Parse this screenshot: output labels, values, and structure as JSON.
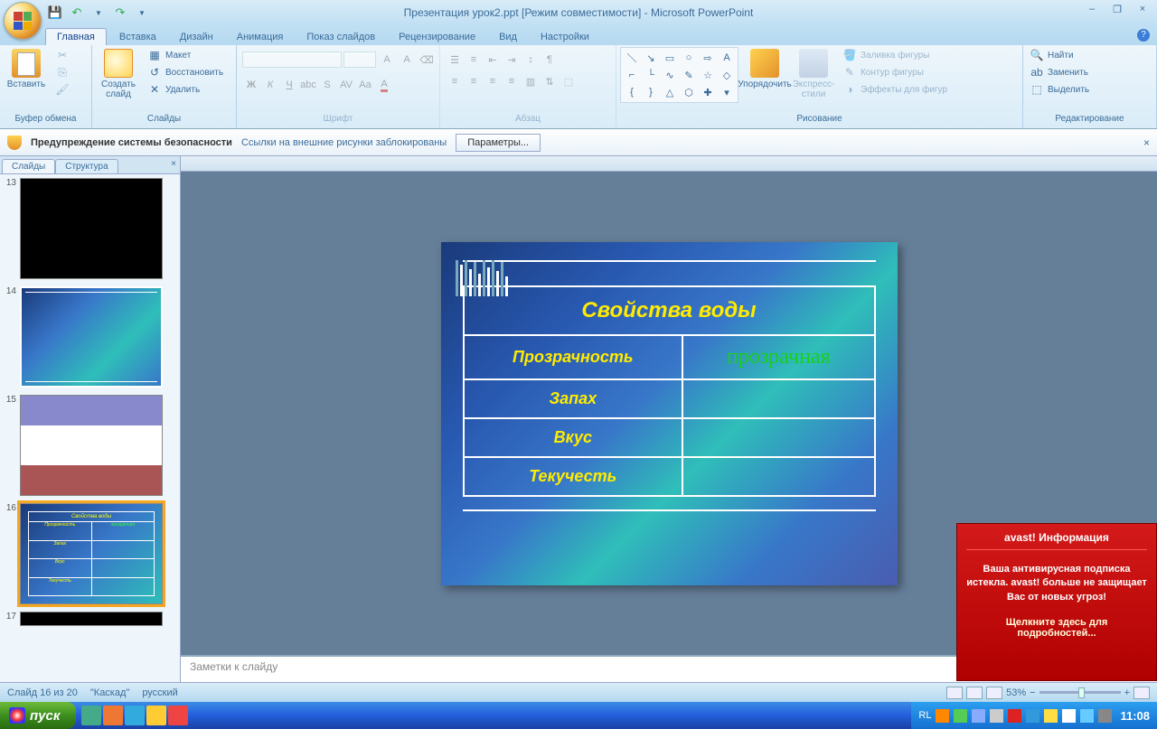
{
  "title": "Презентация урок2.ppt [Режим совместимости] - Microsoft PowerPoint",
  "qat": {
    "save_icon": "💾",
    "undo_icon": "↶",
    "redo_icon": "↷"
  },
  "tabs": [
    "Главная",
    "Вставка",
    "Дизайн",
    "Анимация",
    "Показ слайдов",
    "Рецензирование",
    "Вид",
    "Настройки"
  ],
  "active_tab": 0,
  "ribbon": {
    "clipboard": {
      "label": "Буфер обмена",
      "paste": "Вставить"
    },
    "slides": {
      "label": "Слайды",
      "new": "Создать слайд",
      "layout": "Макет",
      "reset": "Восстановить",
      "delete": "Удалить"
    },
    "font": {
      "label": "Шрифт"
    },
    "paragraph": {
      "label": "Абзац"
    },
    "drawing": {
      "label": "Рисование",
      "arrange": "Упорядочить",
      "styles": "Экспресс-стили",
      "fill": "Заливка фигуры",
      "outline": "Контур фигуры",
      "effects": "Эффекты для фигур"
    },
    "editing": {
      "label": "Редактирование",
      "find": "Найти",
      "replace": "Заменить",
      "select": "Выделить"
    }
  },
  "security": {
    "title": "Предупреждение системы безопасности",
    "text": "Ссылки на внешние рисунки заблокированы",
    "btn": "Параметры..."
  },
  "side": {
    "tabs": [
      "Слайды",
      "Структура"
    ],
    "active": 0,
    "nums": [
      "13",
      "14",
      "15",
      "16",
      "17"
    ]
  },
  "slide": {
    "title": "Свойства воды",
    "rows": [
      {
        "label": "Прозрачность",
        "value": "прозрачная"
      },
      {
        "label": "Запах",
        "value": ""
      },
      {
        "label": "Вкус",
        "value": ""
      },
      {
        "label": "Текучесть",
        "value": ""
      }
    ]
  },
  "notes_placeholder": "Заметки к слайду",
  "status": {
    "slide": "Слайд 16 из 20",
    "theme": "\"Каскад\"",
    "lang": "русский",
    "zoom": "53%"
  },
  "avast": {
    "title": "avast! Информация",
    "body": "Ваша антивирусная подписка истекла. avast! больше не защищает Вас от новых угроз!",
    "link": "Щелкните здесь для подробностей..."
  },
  "taskbar": {
    "start": "пуск",
    "lang": "RL",
    "clock": "11:08"
  }
}
